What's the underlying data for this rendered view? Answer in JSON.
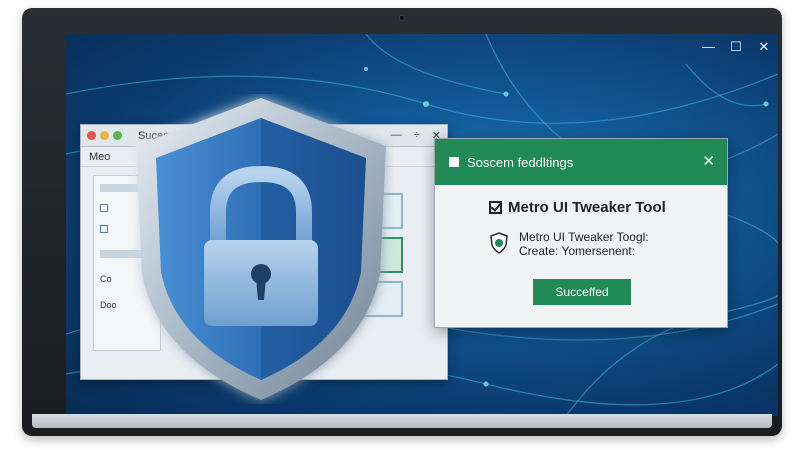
{
  "screen": {
    "window_controls": {
      "minimize": "—",
      "maximize": "☐",
      "close": "✕"
    }
  },
  "back_window": {
    "title": "Sucem",
    "controls": {
      "minimize": "—",
      "resize": "÷",
      "close": "✕"
    },
    "menu": "Meo",
    "side_labels": [
      "Co",
      "Doo"
    ]
  },
  "dialog": {
    "title": "Soscem feddltings",
    "close": "✕",
    "heading": "Metro UI Tweaker Tool",
    "info_line1": "Metro UI Tweaker Toogl:",
    "info_line2": "Create: Yomersenent:",
    "button": "Succeffed",
    "accent": "#1f8a56"
  },
  "colors": {
    "screen_bg": "#125796",
    "shield_blue": "#2f6fb5",
    "dialog_green": "#1f8a56"
  },
  "icons": [
    "lock-icon",
    "shield-icon",
    "checkbox-icon",
    "close-icon"
  ]
}
